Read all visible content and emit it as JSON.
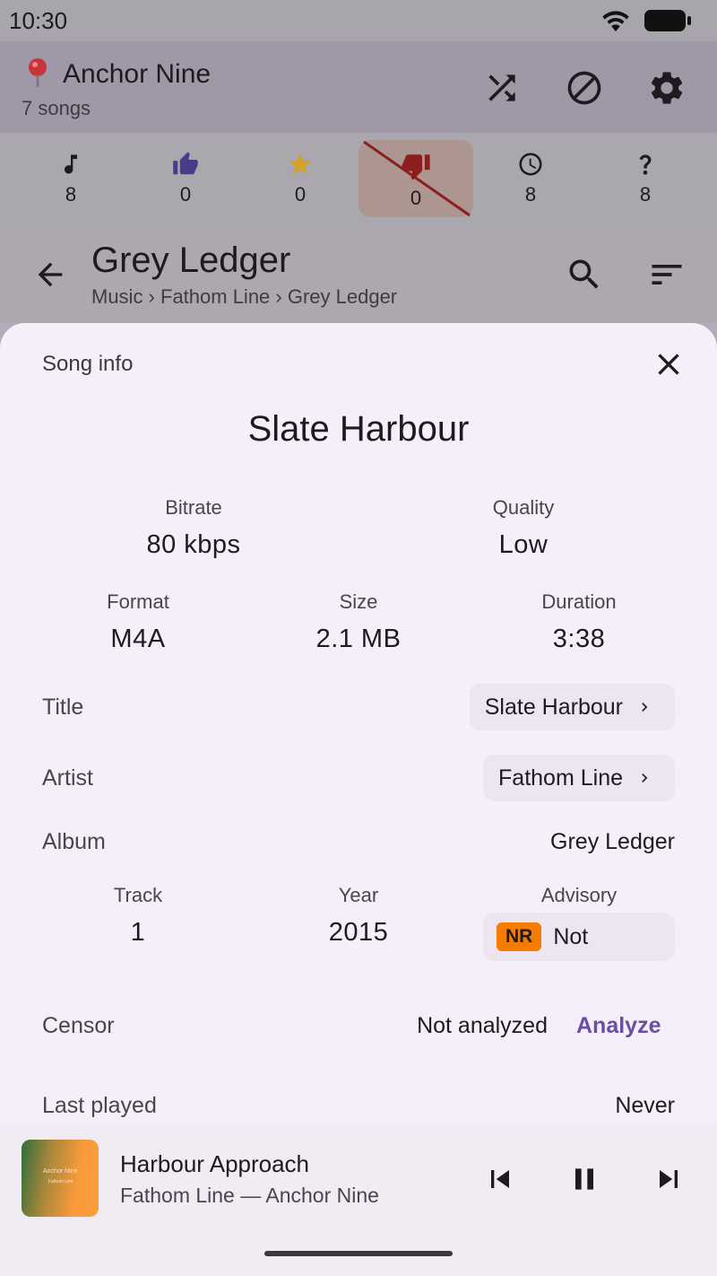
{
  "status_bar": {
    "time": "10:30"
  },
  "app_bar": {
    "title": "Anchor Nine",
    "subtitle": "7 songs",
    "icons": [
      "shuffle-icon",
      "block-icon",
      "gear-icon"
    ]
  },
  "filters": [
    {
      "icon": "music-note-icon",
      "count": "8",
      "active": false
    },
    {
      "icon": "thumbs-up-icon",
      "count": "0",
      "active": false
    },
    {
      "icon": "star-icon",
      "count": "0",
      "active": false
    },
    {
      "icon": "thumbs-down-icon",
      "count": "0",
      "active": true
    },
    {
      "icon": "clock-icon",
      "count": "8",
      "active": false
    },
    {
      "icon": "question-icon",
      "count": "8",
      "active": false
    }
  ],
  "nav": {
    "title": "Grey Ledger",
    "breadcrumb": "Music › Fathom Line › Grey Ledger"
  },
  "sheet": {
    "label": "Song info",
    "song_title": "Slate Harbour",
    "bitrate": {
      "label": "Bitrate",
      "value": "80 kbps"
    },
    "quality": {
      "label": "Quality",
      "value": "Low"
    },
    "format": {
      "label": "Format",
      "value": "M4A"
    },
    "size": {
      "label": "Size",
      "value": "2.1 MB"
    },
    "duration": {
      "label": "Duration",
      "value": "3:38"
    },
    "title_row": {
      "label": "Title",
      "value": "Slate Harbour"
    },
    "artist_row": {
      "label": "Artist",
      "value": "Fathom Line"
    },
    "album_row": {
      "label": "Album",
      "value": "Grey Ledger"
    },
    "track": {
      "label": "Track",
      "value": "1"
    },
    "year": {
      "label": "Year",
      "value": "2015"
    },
    "advisory": {
      "label": "Advisory",
      "badge": "NR",
      "value": "Not"
    },
    "censor_row": {
      "label": "Censor",
      "value": "Not analyzed",
      "action": "Analyze"
    },
    "last_played_row": {
      "label": "Last played",
      "value": "Never"
    }
  },
  "player": {
    "title": "Harbour Approach",
    "subtitle": "Fathom Line — Anchor Nine",
    "art_text": "Anchor Nine",
    "art_sub": "Fathom Line"
  },
  "colors": {
    "accent": "#6750a4",
    "sheet_bg": "#f6eef8",
    "badge": "#f57c00",
    "thumbs_up": "#4a3a8a",
    "star": "#d4a12a",
    "thumbs_down": "#8b1f1f"
  }
}
